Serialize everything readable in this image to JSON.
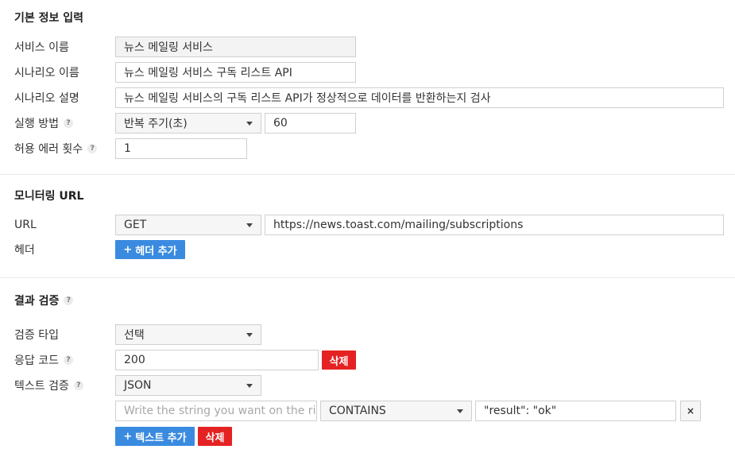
{
  "basic": {
    "title": "기본 정보 입력",
    "service_name_label": "서비스 이름",
    "service_name_value": "뉴스 메일링 서비스",
    "scenario_name_label": "시나리오 이름",
    "scenario_name_value": "뉴스 메일링 서비스 구독 리스트 API",
    "scenario_desc_label": "시나리오 설명",
    "scenario_desc_value": "뉴스 메일링 서비스의 구독 리스트 API가 정상적으로 데이터를 반환하는지 검사",
    "run_method_label": "실행 방법",
    "run_method_value": "반복 주기(초)",
    "run_interval_value": "60",
    "error_count_label": "허용 에러 횟수",
    "error_count_value": "1"
  },
  "monitor": {
    "title": "모니터링 URL",
    "url_label": "URL",
    "method_value": "GET",
    "url_value": "https://news.toast.com/mailing/subscriptions",
    "header_label": "헤더",
    "add_header_label": "헤더 추가"
  },
  "verify": {
    "title": "결과 검증",
    "type_label": "검증 타입",
    "type_value": "선택",
    "response_code_label": "응답 코드",
    "response_code_value": "200",
    "delete_label": "삭제",
    "text_verify_label": "텍스트 검증",
    "text_format_value": "JSON",
    "string_placeholder": "Write the string you want on the righ",
    "operator_value": "CONTAINS",
    "match_value": "\"result\": \"ok\"",
    "remove_symbol": "×",
    "add_text_label": "텍스트 추가",
    "delete_text_label": "삭제"
  },
  "icons": {
    "help": "?",
    "plus": "+"
  },
  "colors": {
    "primary_button": "#3a8be0",
    "danger_button": "#e52222"
  }
}
